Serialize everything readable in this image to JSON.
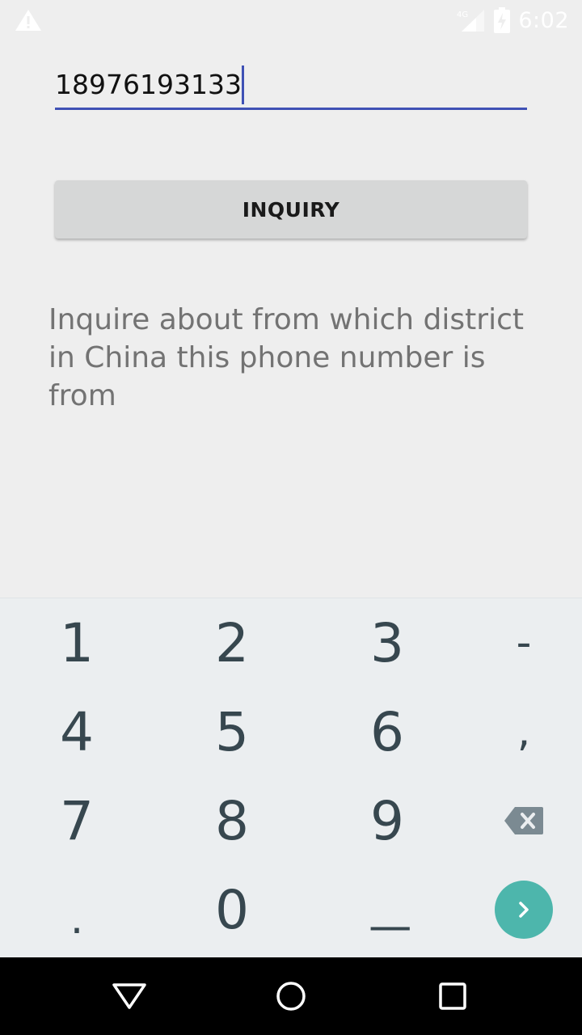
{
  "status_bar": {
    "warning_icon": "warning-triangle-icon",
    "network_label": "4G",
    "time": "6:02"
  },
  "form": {
    "phone_value": "18976193133",
    "accent_color": "#3f51b5",
    "button_label": "INQUIRY",
    "description": "Inquire about from which district in China this phone number is from"
  },
  "keyboard": {
    "rows": [
      [
        "1",
        "2",
        "3",
        "-"
      ],
      [
        "4",
        "5",
        "6",
        ","
      ],
      [
        "7",
        "8",
        "9",
        "backspace-icon"
      ],
      [
        ".",
        "0",
        "_",
        "enter-icon"
      ]
    ],
    "enter_color": "#4db6ac"
  },
  "nav_bar": {
    "back": "back-triangle-icon",
    "home": "home-circle-icon",
    "recents": "recents-square-icon"
  }
}
